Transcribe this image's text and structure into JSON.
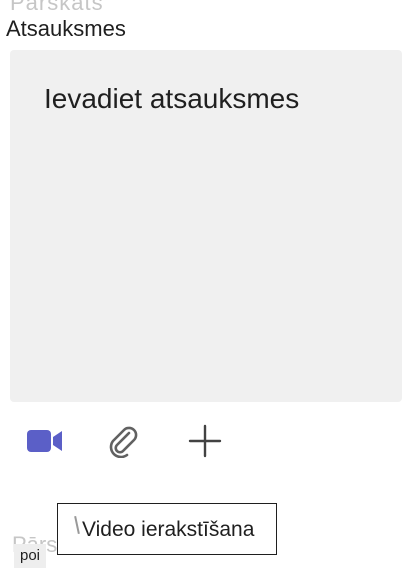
{
  "header": {
    "ghost_text": "Pārskats"
  },
  "feedback": {
    "label": "Atsauksmes",
    "placeholder": "Ievadiet atsauksmes"
  },
  "toolbar": {
    "video_icon": "video-camera-icon",
    "attach_icon": "paperclip-icon",
    "add_icon": "plus-icon",
    "accent_color": "#5b5fc7",
    "icon_color": "#616161"
  },
  "footer": {
    "ghost_text": "Pārskats",
    "chip_label": "poi"
  },
  "tooltip": {
    "text": "Video ierakstīšana"
  }
}
